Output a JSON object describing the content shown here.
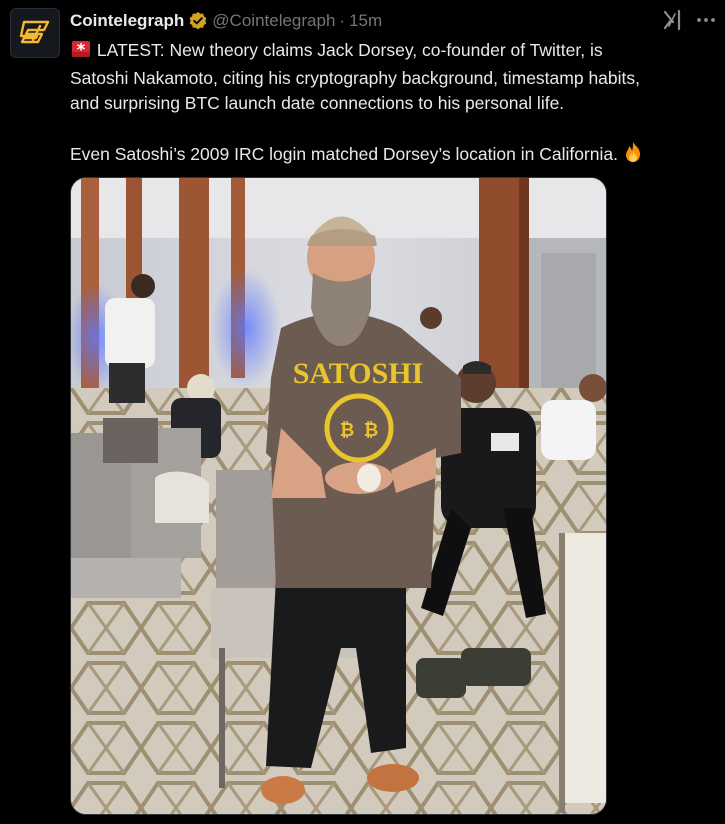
{
  "account": {
    "display_name": "Cointelegraph",
    "handle": "@Cointelegraph",
    "separator": "·",
    "time": "15m",
    "verified_color": "#d6a41c"
  },
  "tweet": {
    "line1": "LATEST: New theory claims Jack Dorsey, co-founder of Twitter, is",
    "line2": "Satoshi Nakamoto, citing his cryptography background, timestamp habits,",
    "line3": "and surprising BTC launch date connections to his personal life.",
    "line4": "Even Satoshi’s 2009 IRC login matched Dorsey’s location in California.",
    "leading_emoji": "rotating-light-icon",
    "trailing_emoji": "fire-icon"
  },
  "photo": {
    "shirt_text": "SATOSHI",
    "shirt_symbol_1": "₿",
    "shirt_symbol_2": "₿"
  },
  "icons": {
    "grok": "grok-icon",
    "more": "more-icon"
  },
  "colors": {
    "background": "#000000",
    "text": "#e7e9ea",
    "muted": "#71767b",
    "border": "#2f3336"
  }
}
